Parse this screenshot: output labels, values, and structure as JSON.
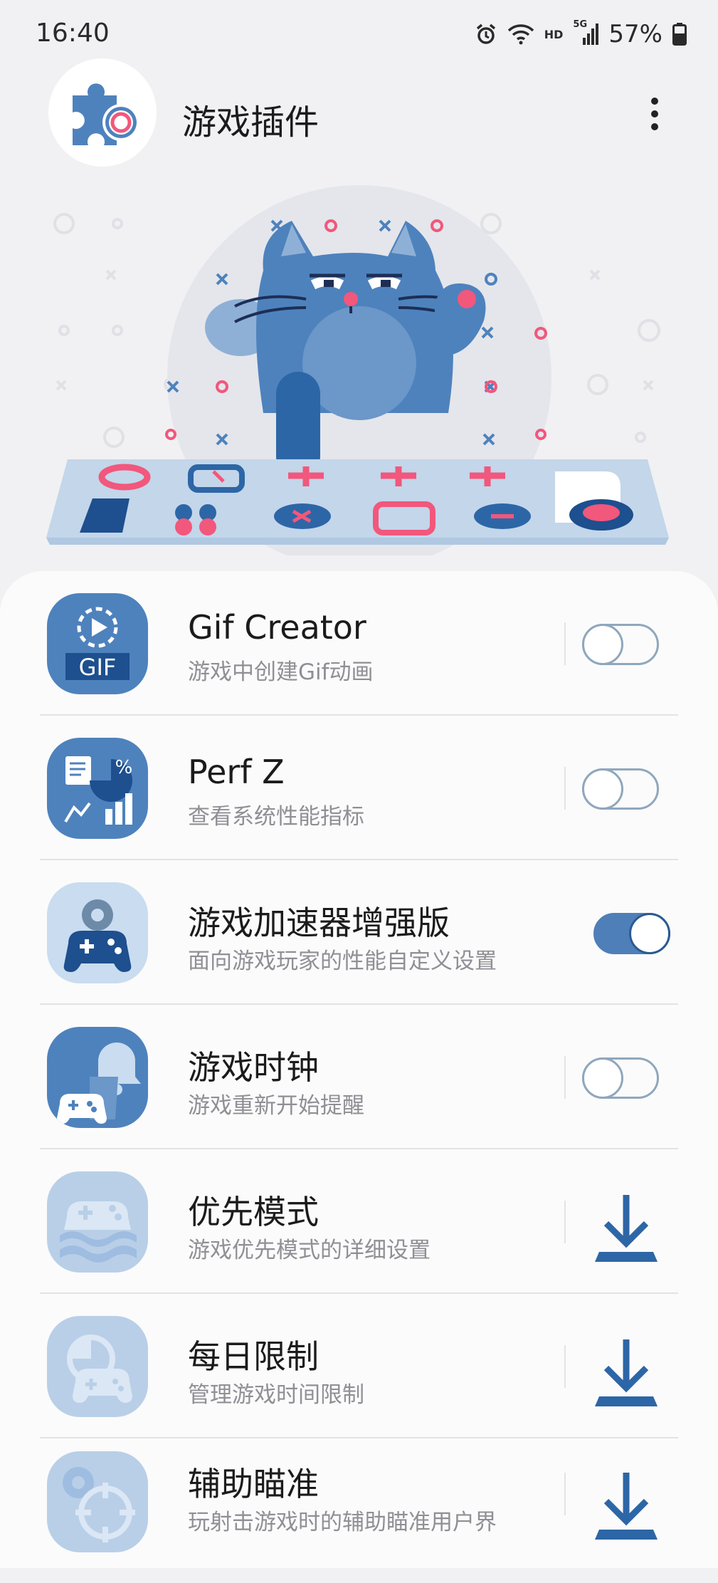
{
  "status_bar": {
    "time": "16:40",
    "hd": "HD",
    "network": "5G",
    "battery": "57%",
    "icons": [
      "alarm-icon",
      "wifi-icon",
      "signal-icon",
      "battery-icon"
    ]
  },
  "header": {
    "title": "游戏插件",
    "logo_icon": "puzzle-gear-icon",
    "menu_icon": "more-vert-icon"
  },
  "hero": {
    "illustration": "cat-keyboard-illustration"
  },
  "colors": {
    "accent": "#4f7fb8",
    "accent_dark": "#2a5a93",
    "toggle_off": "#8fa7bd",
    "pink": "#f2577c",
    "disabled_icon": "#a9c3e0"
  },
  "plugins": [
    {
      "title": "Gif Creator",
      "desc": "游戏中创建Gif动画",
      "action": "toggle",
      "enabled": false,
      "icon": "gif-icon"
    },
    {
      "title": "Perf Z",
      "desc": "查看系统性能指标",
      "action": "toggle",
      "enabled": false,
      "icon": "performance-chart-icon"
    },
    {
      "title": "游戏加速器增强版",
      "desc": "面向游戏玩家的性能自定义设置",
      "action": "toggle",
      "enabled": true,
      "icon": "gamepad-gear-icon"
    },
    {
      "title": "游戏时钟",
      "desc": "游戏重新开始提醒",
      "action": "toggle",
      "enabled": false,
      "icon": "bell-gamepad-icon"
    },
    {
      "title": "优先模式",
      "desc": "游戏优先模式的详细设置",
      "action": "download",
      "icon": "gamepad-waves-icon"
    },
    {
      "title": "每日限制",
      "desc": "管理游戏时间限制",
      "action": "download",
      "icon": "timer-gamepad-icon"
    },
    {
      "title": "辅助瞄准",
      "desc": "玩射击游戏时的辅助瞄准用户界",
      "action": "download",
      "icon": "crosshair-gear-icon"
    }
  ]
}
